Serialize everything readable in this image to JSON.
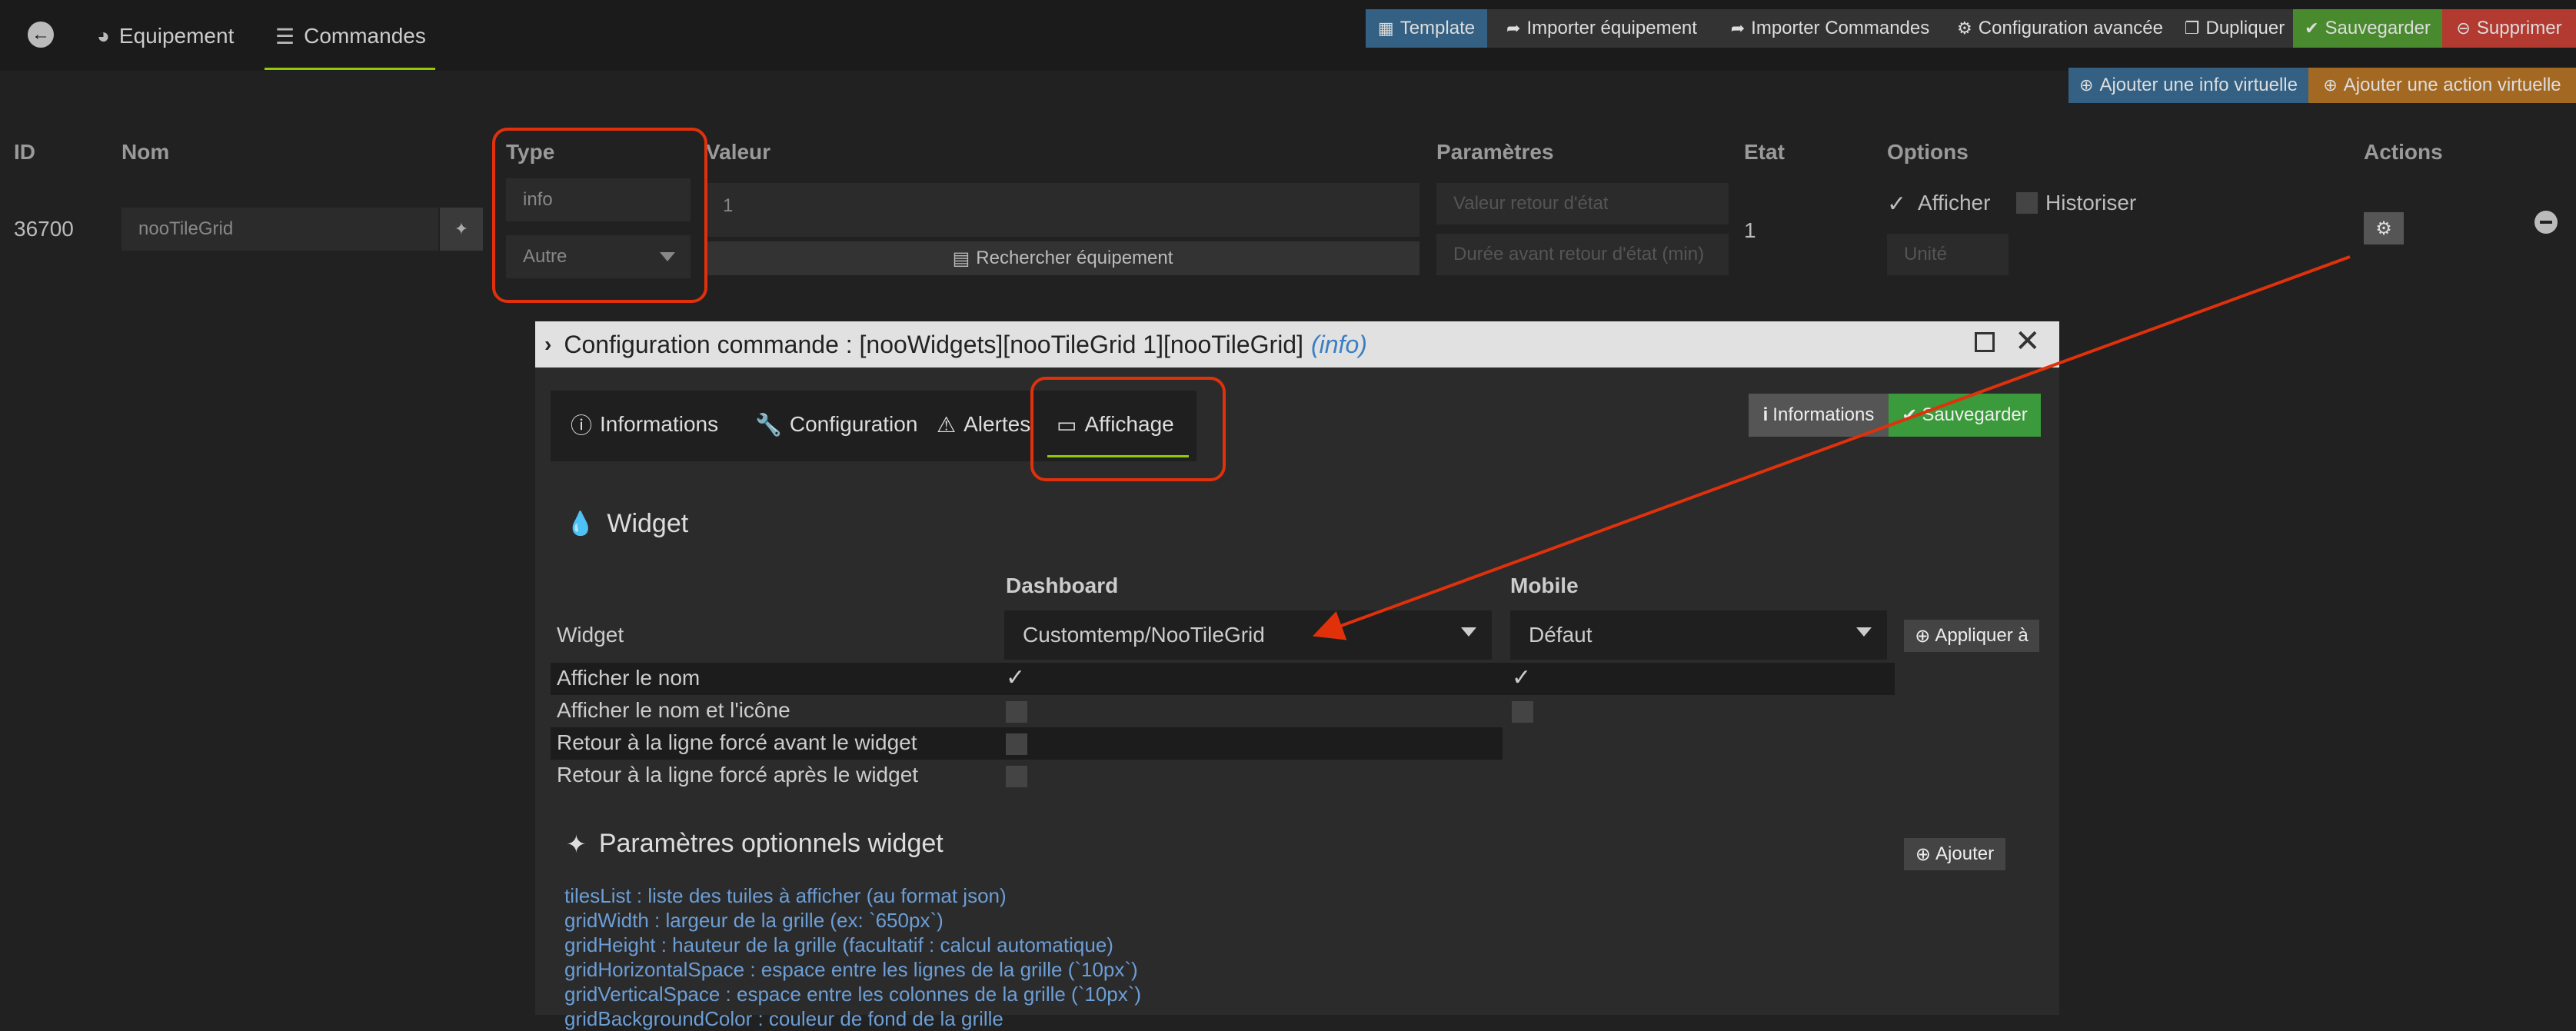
{
  "nav": {
    "back_icon": "arrow-left-circle-icon",
    "tab_equipement": "Equipement",
    "tab_commandes": "Commandes"
  },
  "toolbar": {
    "template": "Template",
    "importer_equipement": "Importer équipement",
    "importer_commandes": "Importer Commandes",
    "config_avancee": "Configuration avancée",
    "dupliquer": "Dupliquer",
    "sauvegarder": "Sauvegarder",
    "supprimer": "Supprimer",
    "ajouter_info": "Ajouter une info virtuelle",
    "ajouter_action": "Ajouter une action virtuelle"
  },
  "table": {
    "headers": {
      "id": "ID",
      "nom": "Nom",
      "type": "Type",
      "valeur": "Valeur",
      "parametres": "Paramètres",
      "etat": "Etat",
      "options": "Options",
      "actions": "Actions"
    },
    "row": {
      "id": "36700",
      "nom": "nooTileGrid",
      "type": "info",
      "subtype": "Autre",
      "valeur": "1",
      "rechercher": "Rechercher équipement",
      "valeur_retour_placeholder": "Valeur retour d'état",
      "duree_placeholder": "Durée avant retour d'état (min)",
      "etat": "1",
      "afficher": "Afficher",
      "historiser": "Historiser",
      "unite_placeholder": "Unité"
    }
  },
  "modal": {
    "title": "Configuration commande : [nooWidgets][nooTileGrid 1][nooTileGrid]",
    "title_suffix": "(info)",
    "tabs": [
      "Informations",
      "Configuration",
      "Alertes",
      "Affichage"
    ],
    "btn_informations": "Informations",
    "btn_sauvegarder": "Sauvegarder",
    "widget_section": "Widget",
    "col_dashboard": "Dashboard",
    "col_mobile": "Mobile",
    "widget_label": "Widget",
    "dashboard_widget": "Customtemp/NooTileGrid",
    "mobile_widget": "Défaut",
    "appliquer": "Appliquer à",
    "options": [
      {
        "label": "Afficher le nom",
        "dashboard": true,
        "mobile": true
      },
      {
        "label": "Afficher le nom et l'icône",
        "dashboard": false,
        "mobile": false
      },
      {
        "label": "Retour à la ligne forcé avant le widget",
        "dashboard": false
      },
      {
        "label": "Retour à la ligne forcé après le widget",
        "dashboard": false
      }
    ],
    "params_section": "Paramètres optionnels widget",
    "ajouter": "Ajouter",
    "params": [
      "tilesList : liste des tuiles à afficher (au format json)",
      "gridWidth : largeur de la grille (ex: `650px`)",
      "gridHeight : hauteur de la grille (facultatif : calcul automatique)",
      "gridHorizontalSpace : espace entre les lignes de la grille (`10px`)",
      "gridVerticalSpace : espace entre les colonnes de la grille (`10px`)",
      "gridBackgroundColor : couleur de fond de la grille"
    ]
  }
}
